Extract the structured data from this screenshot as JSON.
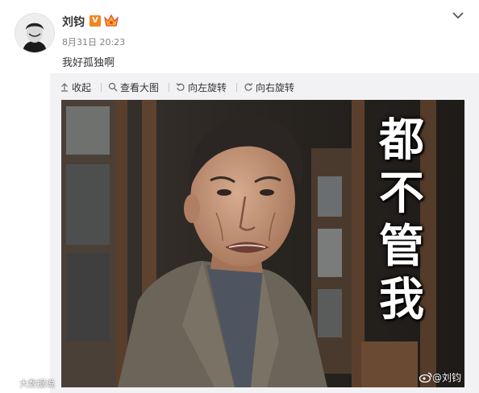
{
  "post": {
    "author": "刘钧",
    "verified_badge": "V",
    "timestamp": "8月31日 20:23",
    "text": "我好孤独啊"
  },
  "toolbar": {
    "collapse_label": "收起",
    "view_large_label": "查看大图",
    "rotate_left_label": "向左旋转",
    "rotate_right_label": "向右旋转"
  },
  "image": {
    "caption_lines": [
      "都",
      "不",
      "管",
      "我"
    ],
    "watermark": "@刘钧"
  },
  "site_watermark": "大数据说",
  "colors": {
    "badge_orange": "#f0861e",
    "muted_text": "#808080",
    "media_background": "#f2f2f5"
  }
}
